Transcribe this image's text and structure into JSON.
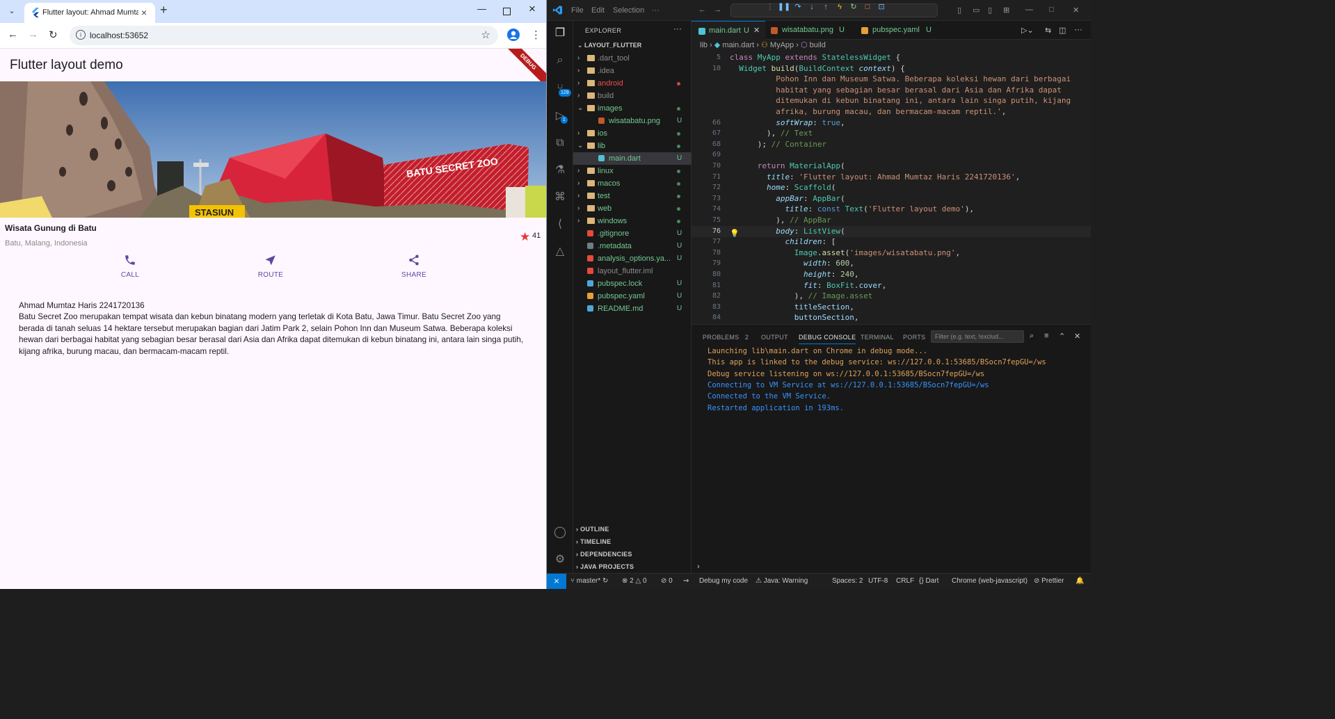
{
  "browser": {
    "tab_title": "Flutter layout: Ahmad Mumtaz",
    "url": "localhost:53652",
    "window_controls": [
      "minimize-icon",
      "maximize-icon",
      "close-icon"
    ]
  },
  "flutter_app": {
    "appbar_title": "Flutter layout demo",
    "debug_banner": "DEBUG",
    "image_sign_text": "BATU SECRET ZOO",
    "image_station_text": "STASIUN",
    "title": "Wisata Gunung di Batu",
    "location": "Batu, Malang, Indonesia",
    "rating": "41",
    "actions": [
      {
        "label": "CALL",
        "icon": "phone-icon"
      },
      {
        "label": "ROUTE",
        "icon": "near-me-icon"
      },
      {
        "label": "SHARE",
        "icon": "share-icon"
      }
    ],
    "author_line": "Ahmad Mumtaz Haris 2241720136",
    "description": "Batu Secret Zoo merupakan tempat wisata dan kebun binatang modern yang terletak di Kota Batu, Jawa Timur. Batu Secret Zoo yang berada di tanah seluas 14 hektare tersebut merupakan bagian dari Jatim Park 2, selain Pohon Inn dan Museum Satwa. Beberapa koleksi hewan dari berbagai habitat yang sebagian besar berasal dari Asia dan Afrika dapat ditemukan di kebun binatang ini, antara lain singa putih, kijang afrika, burung macau, dan bermacam-macam reptil.",
    "colors": {
      "accent": "#5b4aa0",
      "star": "#e53935",
      "background": "#fef7ff"
    }
  },
  "vscode": {
    "menu": [
      "File",
      "Edit",
      "Selection",
      "···"
    ],
    "explorer": {
      "header": "EXPLORER",
      "root": "LAYOUT_FLUTTER",
      "items": [
        {
          "name": ".dart_tool",
          "type": "folder",
          "expanded": false,
          "color": "#8b8b8b",
          "status": ""
        },
        {
          "name": ".idea",
          "type": "folder",
          "expanded": false,
          "color": "#8b8b8b",
          "status": ""
        },
        {
          "name": "android",
          "type": "folder",
          "expanded": false,
          "color": "#f14c4c",
          "status": "dot-red"
        },
        {
          "name": "build",
          "type": "folder",
          "expanded": false,
          "color": "#8b8b8b",
          "status": ""
        },
        {
          "name": "images",
          "type": "folder",
          "expanded": true,
          "color": "#73c991",
          "status": "dot-green"
        },
        {
          "name": "wisatabatu.png",
          "type": "image",
          "expanded": false,
          "color": "#73c991",
          "status": "U"
        },
        {
          "name": "ios",
          "type": "folder",
          "expanded": false,
          "color": "#73c991",
          "status": "dot-green"
        },
        {
          "name": "lib",
          "type": "folder",
          "expanded": true,
          "color": "#73c991",
          "status": "dot-green"
        },
        {
          "name": "main.dart",
          "type": "dart",
          "expanded": false,
          "color": "#73c991",
          "status": "U"
        },
        {
          "name": "linux",
          "type": "folder",
          "expanded": false,
          "color": "#73c991",
          "status": "dot-green"
        },
        {
          "name": "macos",
          "type": "folder",
          "expanded": false,
          "color": "#73c991",
          "status": "dot-green"
        },
        {
          "name": "test",
          "type": "folder",
          "expanded": false,
          "color": "#73c991",
          "status": "dot-green"
        },
        {
          "name": "web",
          "type": "folder",
          "expanded": false,
          "color": "#73c991",
          "status": "dot-green"
        },
        {
          "name": "windows",
          "type": "folder",
          "expanded": false,
          "color": "#73c991",
          "status": "dot-green"
        },
        {
          "name": ".gitignore",
          "type": "git",
          "expanded": false,
          "color": "#73c991",
          "status": "U"
        },
        {
          "name": ".metadata",
          "type": "file",
          "expanded": false,
          "color": "#73c991",
          "status": "U"
        },
        {
          "name": "analysis_options.ya...",
          "type": "yaml-red",
          "expanded": false,
          "color": "#73c991",
          "status": "U"
        },
        {
          "name": "layout_flutter.iml",
          "type": "xml",
          "expanded": false,
          "color": "#8b8b8b",
          "status": ""
        },
        {
          "name": "pubspec.lock",
          "type": "lock",
          "expanded": false,
          "color": "#73c991",
          "status": "U"
        },
        {
          "name": "pubspec.yaml",
          "type": "yaml",
          "expanded": false,
          "color": "#73c991",
          "status": "U"
        },
        {
          "name": "README.md",
          "type": "md",
          "expanded": false,
          "color": "#73c991",
          "status": "U"
        }
      ],
      "sections": [
        "OUTLINE",
        "TIMELINE",
        "DEPENDENCIES",
        "JAVA PROJECTS"
      ]
    },
    "tabs": [
      {
        "label": "main.dart",
        "status": "U",
        "active": true
      },
      {
        "label": "wisatabatu.png",
        "status": "U",
        "active": false
      },
      {
        "label": "pubspec.yaml",
        "status": "U",
        "active": false
      }
    ],
    "breadcrumb": [
      "lib",
      "main.dart",
      "MyApp",
      "build"
    ],
    "code_lines": [
      {
        "n": "5",
        "html": "<span class='kw'>class</span> <span class='ty'>MyApp</span> <span class='kw'>extends</span> <span class='ty'>StatelessWidget</span> <span class='pl'>{</span>",
        "sticky": true
      },
      {
        "n": "10",
        "html": "  <span class='ty'>Widget</span> <span class='fn'>build</span><span class='pl'>(</span><span class='ty'>BuildContext</span> <span class='pr'><i>context</i></span><span class='pl'>) {</span>",
        "sticky": true
      },
      {
        "n": "",
        "html": "          <span class='str'>Pohon Inn dan Museum Satwa. Beberapa koleksi hewan dari berbagai</span>"
      },
      {
        "n": "",
        "html": "          <span class='str'>habitat yang sebagian besar berasal dari Asia dan Afrika dapat</span>"
      },
      {
        "n": "",
        "html": "          <span class='str'>ditemukan di kebun binatang ini, antara lain singa putih, kijang</span>"
      },
      {
        "n": "",
        "html": "          <span class='str'>afrika, burung macau, dan bermacam-macam reptil.'</span><span class='pl'>,</span>"
      },
      {
        "n": "66",
        "html": "          <span class='pr'><i>softWrap</i></span><span class='pl'>: </span><span class='cls'>true</span><span class='pl'>,</span>"
      },
      {
        "n": "67",
        "html": "        <span class='pl'>), </span><span class='cm'>// Text</span>"
      },
      {
        "n": "68",
        "html": "      <span class='pl'>); </span><span class='cm'>// Container</span>"
      },
      {
        "n": "69",
        "html": ""
      },
      {
        "n": "70",
        "html": "      <span class='kw'>return</span> <span class='ty'>MaterialApp</span><span class='pl'>(</span>"
      },
      {
        "n": "71",
        "html": "        <span class='pr'><i>title</i></span><span class='pl'>: </span><span class='str'>'Flutter layout: Ahmad Mumtaz Haris 2241720136'</span><span class='pl'>,</span>"
      },
      {
        "n": "72",
        "html": "        <span class='pr'><i>home</i></span><span class='pl'>: </span><span class='ty'>Scaffold</span><span class='pl'>(</span>"
      },
      {
        "n": "73",
        "html": "          <span class='pr'><i>appBar</i></span><span class='pl'>: </span><span class='ty'>AppBar</span><span class='pl'>(</span>"
      },
      {
        "n": "74",
        "html": "            <span class='pr'><i>title</i></span><span class='pl'>: </span><span class='cls'>const</span> <span class='ty'>Text</span><span class='pl'>(</span><span class='str'>'Flutter layout demo'</span><span class='pl'>),</span>"
      },
      {
        "n": "75",
        "html": "          <span class='pl'>), </span><span class='cm'>// AppBar</span>"
      },
      {
        "n": "76",
        "html": "          <span class='pr'><i>body</i></span><span class='pl'>: </span><span class='ty'>ListView</span><span class='pl'>(</span>",
        "current": true
      },
      {
        "n": "77",
        "html": "            <span class='pr'><i>children</i></span><span class='pl'>: [</span>"
      },
      {
        "n": "78",
        "html": "              <span class='ty'>Image</span><span class='pl'>.</span><span class='fn'>asset</span><span class='pl'>(</span><span class='str'>'images/wisatabatu.png'</span><span class='pl'>,</span>"
      },
      {
        "n": "79",
        "html": "                <span class='pr'><i>width</i></span><span class='pl'>: </span><span class='num'>600</span><span class='pl'>,</span>"
      },
      {
        "n": "80",
        "html": "                <span class='pr'><i>height</i></span><span class='pl'>: </span><span class='num'>240</span><span class='pl'>,</span>"
      },
      {
        "n": "81",
        "html": "                <span class='pr'><i>fit</i></span><span class='pl'>: </span><span class='ty'>BoxFit</span><span class='pl'>.</span><span class='pr'>cover</span><span class='pl'>,</span>"
      },
      {
        "n": "82",
        "html": "              <span class='pl'>), </span><span class='cm'>// Image.asset</span>"
      },
      {
        "n": "83",
        "html": "              <span class='pr'>titleSection</span><span class='pl'>,</span>"
      },
      {
        "n": "84",
        "html": "              <span class='pr'>buttonSection</span><span class='pl'>,</span>"
      }
    ],
    "panel": {
      "tabs": [
        "PROBLEMS",
        "OUTPUT",
        "DEBUG CONSOLE",
        "TERMINAL",
        "PORTS"
      ],
      "problems_count": "2",
      "filter_placeholder": "Filter (e.g. text, !exclud...",
      "console": [
        {
          "text": "Launching lib\\main.dart on Chrome in debug mode...",
          "color": "#e0a15b"
        },
        {
          "text": "This app is linked to the debug service: ws://127.0.0.1:53685/BSocn7fepGU=/ws",
          "color": "#e0a15b"
        },
        {
          "text": "Debug service listening on ws://127.0.0.1:53685/BSocn7fepGU=/ws",
          "color": "#e0a15b"
        },
        {
          "text": "Connecting to VM Service at ws://127.0.0.1:53685/BSocn7fepGU=/ws",
          "color": "#3794ff"
        },
        {
          "text": "Connected to the VM Service.",
          "color": "#3794ff"
        },
        {
          "text": "Restarted application in 193ms.",
          "color": "#3794ff"
        }
      ]
    },
    "statusbar": {
      "branch": "master*",
      "errors": "2",
      "warnings": "0",
      "info": "0",
      "debug_config": "Debug my code",
      "java": "Java: Warning",
      "spaces": "Spaces: 2",
      "encoding": "UTF-8",
      "eol": "CRLF",
      "language": "Dart",
      "device": "Chrome (web-javascript)",
      "formatter": "Prettier"
    },
    "activity_badges": {
      "source_control": "129",
      "run_debug": "1"
    }
  }
}
